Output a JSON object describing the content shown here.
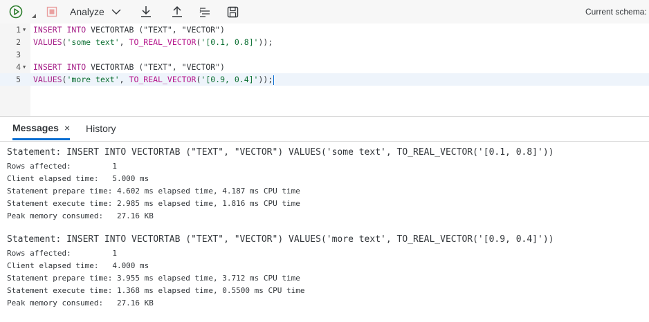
{
  "toolbar": {
    "run_icon": "run-icon",
    "stop_icon": "stop-icon",
    "analyze_label": "Analyze",
    "download_icon": "download-icon",
    "upload_icon": "upload-icon",
    "format_icon": "format-icon",
    "save_icon": "save-icon",
    "current_schema_label": "Current schema: T"
  },
  "editor": {
    "lines": [
      {
        "num": "1",
        "fold": "▼"
      },
      {
        "num": "2",
        "fold": ""
      },
      {
        "num": "3",
        "fold": ""
      },
      {
        "num": "4",
        "fold": "▼"
      },
      {
        "num": "5",
        "fold": ""
      }
    ],
    "line1": {
      "a": "INSERT INTO",
      "b": " VECTORTAB (\"TEXT\", \"VECTOR\")"
    },
    "line2": {
      "a": "VALUES",
      "b": "(",
      "c": "'some text'",
      "d": ", ",
      "e": "TO_REAL_VECTOR",
      "f": "(",
      "g": "'[0.1, 0.8]'",
      "h": "));"
    },
    "line4": {
      "a": "INSERT INTO",
      "b": " VECTORTAB (\"TEXT\", \"VECTOR\")"
    },
    "line5": {
      "a": "VALUES",
      "b": "(",
      "c": "'more text'",
      "d": ", ",
      "e": "TO_REAL_VECTOR",
      "f": "(",
      "g": "'[0.9, 0.4]'",
      "h": "));"
    }
  },
  "tabs": {
    "messages": "Messages",
    "close": "×",
    "history": "History"
  },
  "messages": [
    {
      "statement": "Statement: INSERT INTO VECTORTAB (\"TEXT\", \"VECTOR\") VALUES('some text', TO_REAL_VECTOR('[0.1, 0.8]'))",
      "rows_affected": "Rows affected:         1",
      "client_elapsed": "Client elapsed time:   5.000 ms",
      "prepare_time": "Statement prepare time: 4.602 ms elapsed time, 4.187 ms CPU time",
      "execute_time": "Statement execute time: 2.985 ms elapsed time, 1.816 ms CPU time",
      "peak_memory": "Peak memory consumed:   27.16 KB"
    },
    {
      "statement": "Statement: INSERT INTO VECTORTAB (\"TEXT\", \"VECTOR\") VALUES('more text', TO_REAL_VECTOR('[0.9, 0.4]'))",
      "rows_affected": "Rows affected:         1",
      "client_elapsed": "Client elapsed time:   4.000 ms",
      "prepare_time": "Statement prepare time: 3.955 ms elapsed time, 3.712 ms CPU time",
      "execute_time": "Statement execute time: 1.368 ms elapsed time, 0.5500 ms CPU time",
      "peak_memory": "Peak memory consumed:   27.16 KB"
    }
  ]
}
